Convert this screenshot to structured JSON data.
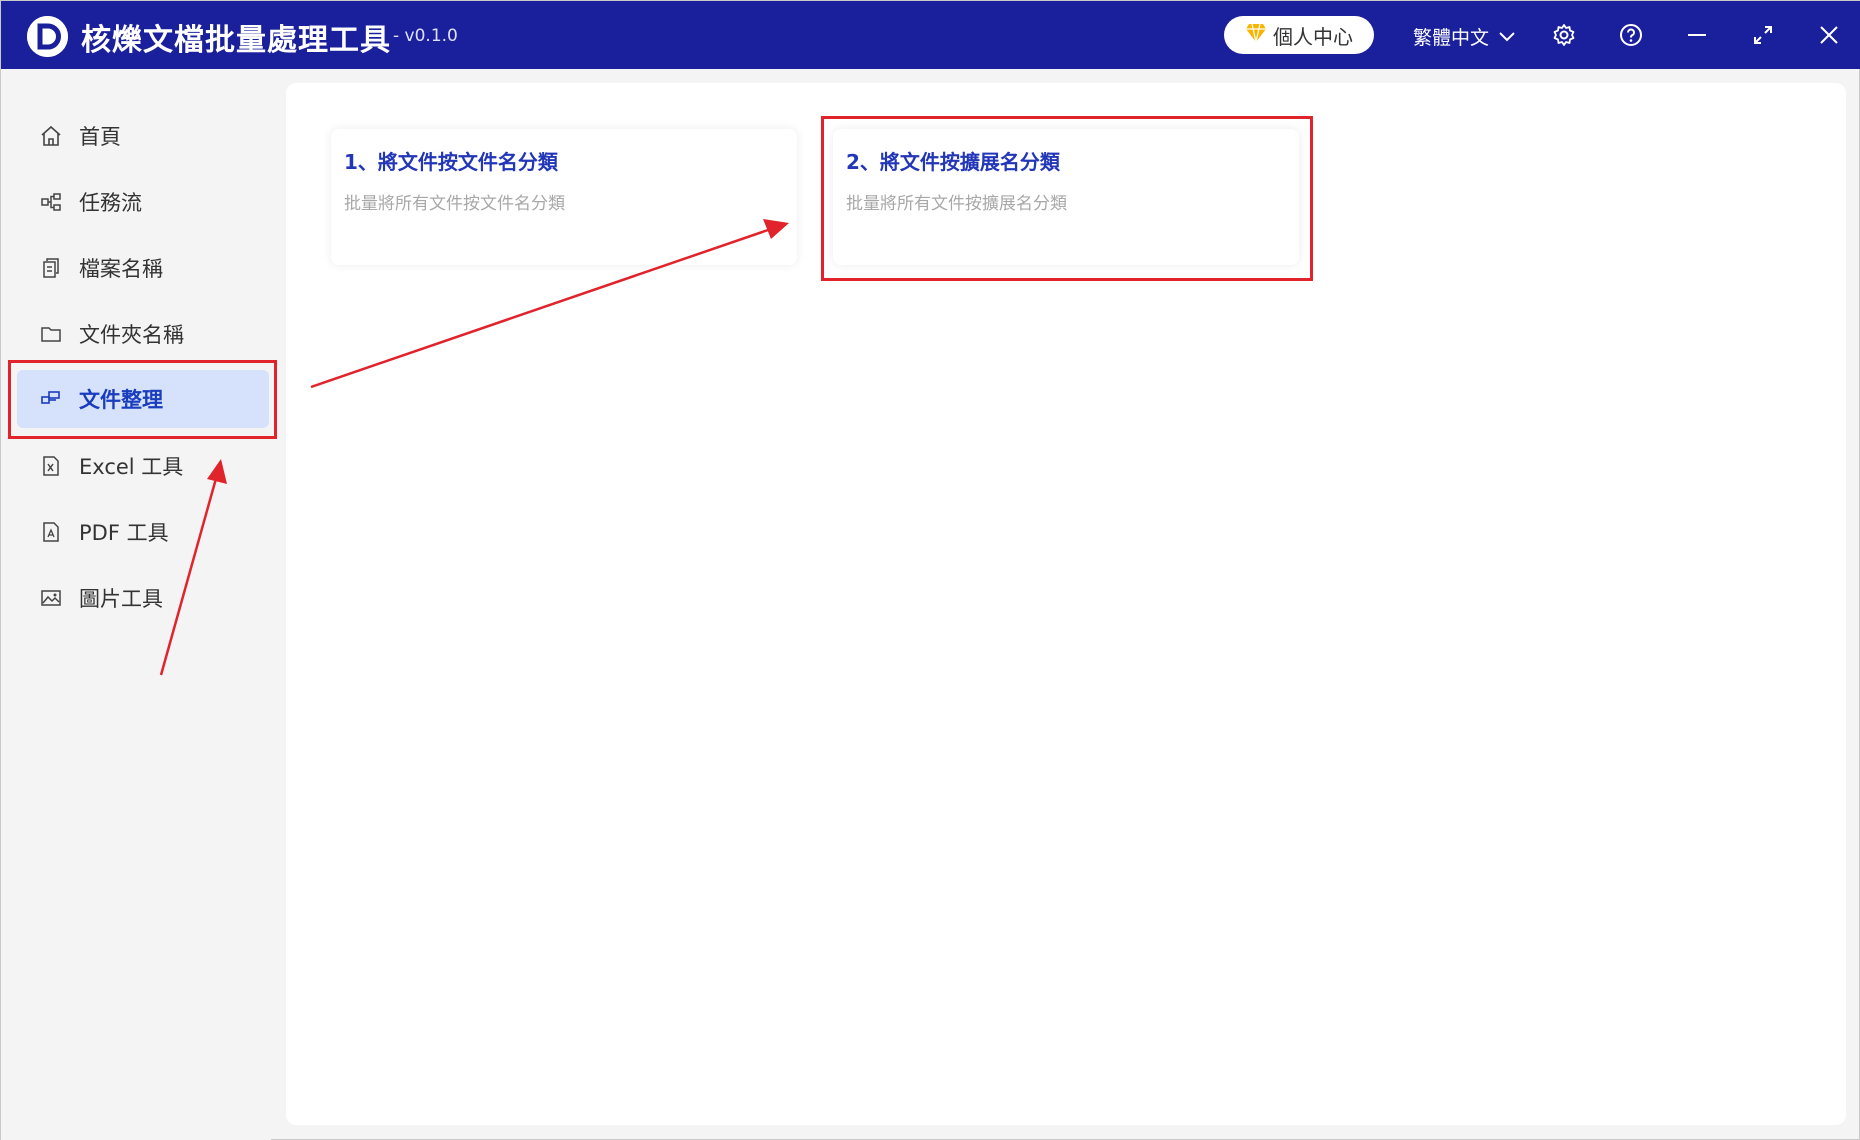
{
  "titlebar": {
    "app_title": "核爍文檔批量處理工具",
    "version": "- v0.1.0",
    "personal_center": "個人中心",
    "language": "繁體中文"
  },
  "sidebar": {
    "items": [
      {
        "label": "首頁",
        "icon": "home-icon"
      },
      {
        "label": "任務流",
        "icon": "workflow-icon"
      },
      {
        "label": "檔案名稱",
        "icon": "file-copy-icon"
      },
      {
        "label": "文件夾名稱",
        "icon": "folder-icon"
      },
      {
        "label": "文件整理",
        "icon": "organize-icon",
        "active": true
      },
      {
        "label": "Excel 工具",
        "icon": "excel-icon"
      },
      {
        "label": "PDF 工具",
        "icon": "pdf-icon"
      },
      {
        "label": "圖片工具",
        "icon": "image-icon"
      }
    ]
  },
  "main": {
    "cards": [
      {
        "title": "1、將文件按文件名分類",
        "desc": "批量將所有文件按文件名分類"
      },
      {
        "title": "2、將文件按擴展名分類",
        "desc": "批量將所有文件按擴展名分類"
      }
    ]
  },
  "colors": {
    "titlebar": "#1a1f9c",
    "accent": "#2236b8",
    "active_bg": "#d6e2fb",
    "highlight": "#e1232b"
  }
}
